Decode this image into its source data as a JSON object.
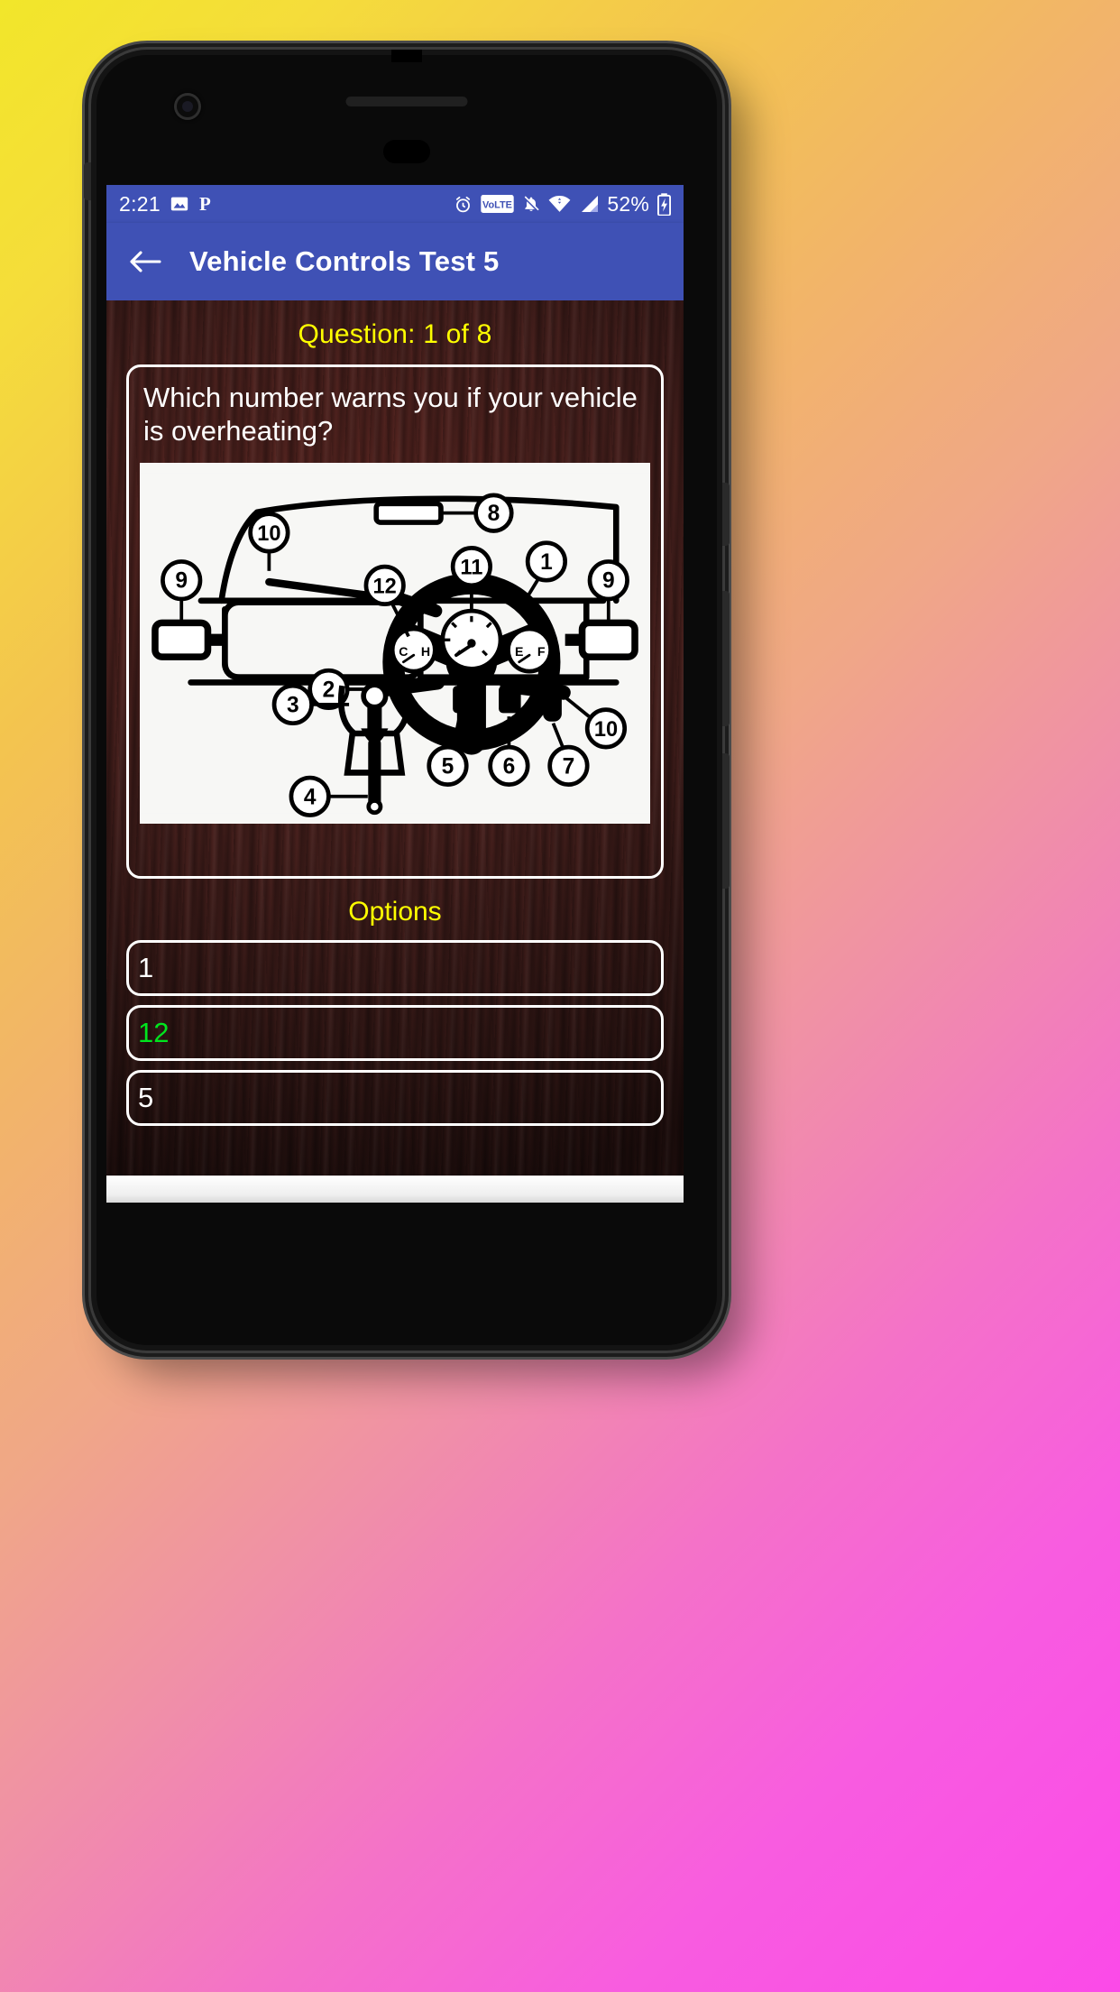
{
  "status_bar": {
    "time": "2:21",
    "battery_percent": "52%",
    "icons_left": [
      "image-icon",
      "pinterest-p-icon"
    ],
    "icons_right": [
      "alarm-clock-icon",
      "volte-icon",
      "bell-muted-icon",
      "wifi-icon",
      "cellular-signal-icon",
      "battery-charging-icon"
    ],
    "volte_label": "VoLTE",
    "background_color": "#3f51b5"
  },
  "app_bar": {
    "back_icon": "back-arrow-icon",
    "title": "Vehicle Controls Test 5",
    "background_color": "#3f51b5"
  },
  "quiz": {
    "counter": "Question: 1 of 8",
    "counter_color": "#ffff00",
    "question": "Which number warns you if your vehicle is overheating?",
    "question_color": "#ffffff",
    "options_title": "Options",
    "options_title_color": "#ffff00",
    "options": [
      {
        "label": "1",
        "color": "#ffffff",
        "state": "unselected"
      },
      {
        "label": "12",
        "color": "#00e51e",
        "state": "selected-correct"
      },
      {
        "label": "5",
        "color": "#ffffff",
        "state": "unselected"
      }
    ]
  },
  "diagram": {
    "name": "car-dashboard-controls-diagram",
    "description": "Line drawing of a car interior dashboard with numbered callouts",
    "callouts": [
      {
        "number": "1",
        "refers_to": "steering-wheel"
      },
      {
        "number": "2",
        "refers_to": "indicator-stalk-left"
      },
      {
        "number": "3",
        "refers_to": "gear-lever"
      },
      {
        "number": "4",
        "refers_to": "handbrake"
      },
      {
        "number": "5",
        "refers_to": "clutch-pedal"
      },
      {
        "number": "6",
        "refers_to": "brake-pedal"
      },
      {
        "number": "7",
        "refers_to": "accelerator-pedal"
      },
      {
        "number": "8",
        "refers_to": "rear-view-mirror"
      },
      {
        "number": "9",
        "refers_to": "wing-mirror"
      },
      {
        "number": "10",
        "refers_to": "windscreen-wiper"
      },
      {
        "number": "11",
        "refers_to": "speedometer"
      },
      {
        "number": "12",
        "refers_to": "temperature-gauge"
      }
    ],
    "gauge_labels": {
      "temp_cold": "C",
      "temp_hot": "H",
      "fuel_empty": "E",
      "fuel_full": "F"
    }
  },
  "theme": {
    "gradient_start": "#f2e62a",
    "gradient_mid": "#f0a787",
    "gradient_end": "#fb4ae8",
    "wood_background": "#47201d",
    "accent_blue": "#3f51b5"
  }
}
